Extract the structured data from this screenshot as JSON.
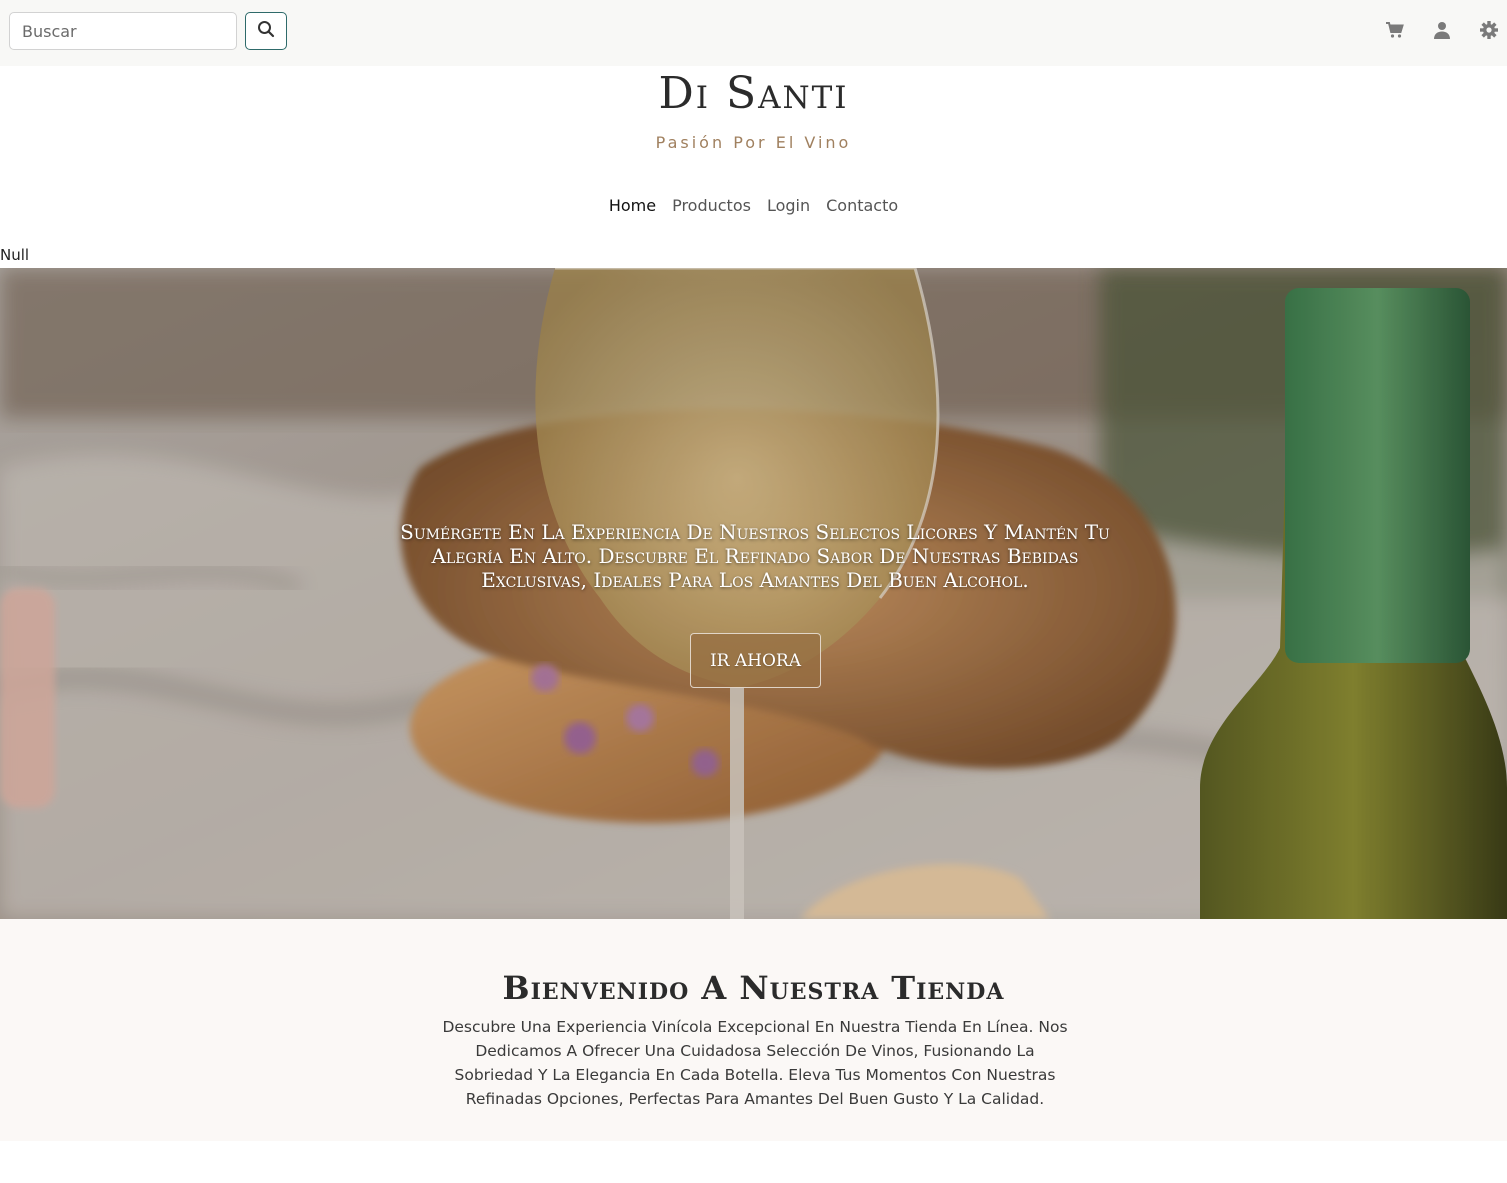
{
  "search": {
    "placeholder": "Buscar"
  },
  "top_icons": [
    "search-icon",
    "cart-icon",
    "user-icon",
    "gear-icon"
  ],
  "brand": {
    "title": "Di Santi",
    "subtitle": "Pasión Por El Vino"
  },
  "nav": {
    "items": [
      {
        "label": "Home",
        "active": true
      },
      {
        "label": "Productos",
        "active": false
      },
      {
        "label": "Login",
        "active": false
      },
      {
        "label": "Contacto",
        "active": false
      }
    ]
  },
  "debug_text": "Null",
  "hero": {
    "text": "Sumérgete En La Experiencia De Nuestros Selectos Licores Y Mantén Tu Alegría En Alto. Descubre El Refinado Sabor De Nuestras Bebidas Exclusivas, Ideales Para Los Amantes Del Buen Alcohol.",
    "button_label": "IR AHORA"
  },
  "welcome": {
    "title": "Bienvenido A Nuestra Tienda",
    "text": "Descubre Una Experiencia Vinícola Excepcional En Nuestra Tienda En Línea. Nos Dedicamos A Ofrecer Una Cuidadosa Selección De Vinos, Fusionando La Sobriedad Y La Elegancia En Cada Botella. Eleva Tus Momentos Con Nuestras Refinadas Opciones, Perfectas Para Amantes Del Buen Gusto Y La Calidad."
  },
  "colors": {
    "accent": "#2e6a6a",
    "brand_sub": "#a0805f",
    "button": "#966e41"
  }
}
